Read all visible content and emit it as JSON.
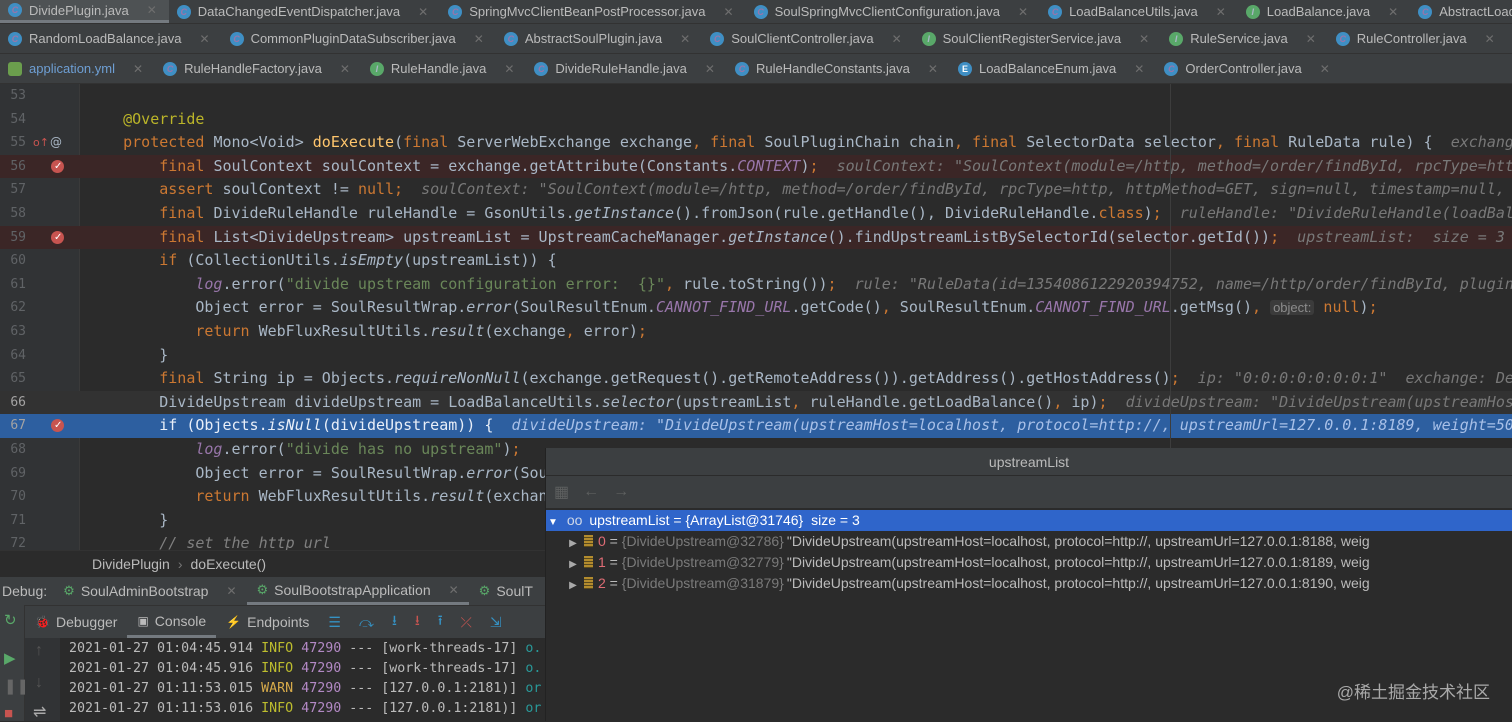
{
  "editor_tabs": [
    [
      {
        "label": "DividePlugin.java",
        "icon": "c",
        "active": true
      },
      {
        "label": "DataChangedEventDispatcher.java",
        "icon": "c"
      },
      {
        "label": "SpringMvcClientBeanPostProcessor.java",
        "icon": "c"
      },
      {
        "label": "SoulSpringMvcClientConfiguration.java",
        "icon": "c"
      },
      {
        "label": "LoadBalanceUtils.java",
        "icon": "c"
      },
      {
        "label": "LoadBalance.java",
        "icon": "i"
      },
      {
        "label": "AbstractLoadBalance.java",
        "icon": "c"
      }
    ],
    [
      {
        "label": "RandomLoadBalance.java",
        "icon": "c"
      },
      {
        "label": "CommonPluginDataSubscriber.java",
        "icon": "c"
      },
      {
        "label": "AbstractSoulPlugin.java",
        "icon": "c"
      },
      {
        "label": "SoulClientController.java",
        "icon": "c"
      },
      {
        "label": "SoulClientRegisterService.java",
        "icon": "i"
      },
      {
        "label": "RuleService.java",
        "icon": "i"
      },
      {
        "label": "RuleController.java",
        "icon": "c"
      }
    ],
    [
      {
        "label": "application.yml",
        "icon": "yml"
      },
      {
        "label": "RuleHandleFactory.java",
        "icon": "c"
      },
      {
        "label": "RuleHandle.java",
        "icon": "i"
      },
      {
        "label": "DivideRuleHandle.java",
        "icon": "c"
      },
      {
        "label": "RuleHandleConstants.java",
        "icon": "c"
      },
      {
        "label": "LoadBalanceEnum.java",
        "icon": "e"
      },
      {
        "label": "OrderController.java",
        "icon": "c"
      }
    ]
  ],
  "code_lines": [
    {
      "n": 53,
      "tokens": []
    },
    {
      "n": 54,
      "tokens": [
        [
          "a",
          "    @Override"
        ]
      ]
    },
    {
      "n": 55,
      "marks": [
        "override",
        "annotation"
      ],
      "tokens": [
        [
          "k",
          "    protected "
        ],
        [
          "t",
          "Mono<Void> "
        ],
        [
          "m",
          "doExecute"
        ],
        [
          "t",
          "("
        ],
        [
          "k",
          "final "
        ],
        [
          "t",
          "ServerWebExchange exchange"
        ],
        [
          "k",
          ", final "
        ],
        [
          "t",
          "SoulPluginChain chain"
        ],
        [
          "k",
          ", final "
        ],
        [
          "t",
          "SelectorData selector"
        ],
        [
          "k",
          ", final "
        ],
        [
          "t",
          "RuleData rule) {  "
        ],
        [
          "h",
          "exchang"
        ]
      ]
    },
    {
      "n": 56,
      "state": "bp",
      "marks": [
        "breakpoint"
      ],
      "tokens": [
        [
          "k",
          "        final "
        ],
        [
          "t",
          "SoulContext soulContext = exchange.getAttribute(Constants."
        ],
        [
          "c",
          "CONTEXT"
        ],
        [
          "t",
          ")"
        ],
        [
          "k",
          ";"
        ],
        [
          "h",
          "  soulContext: \"SoulContext(module=/http, method=/order/findById, rpcType=htt"
        ]
      ]
    },
    {
      "n": 57,
      "tokens": [
        [
          "k",
          "        assert "
        ],
        [
          "t",
          "soulContext != "
        ],
        [
          "k",
          "null;"
        ],
        [
          "h",
          "  soulContext: \"SoulContext(module=/http, method=/order/findById, rpcType=http, httpMethod=GET, sign=null, timestamp=null,"
        ]
      ]
    },
    {
      "n": 58,
      "tokens": [
        [
          "k",
          "        final "
        ],
        [
          "t",
          "DivideRuleHandle ruleHandle = GsonUtils."
        ],
        [
          "i",
          "getInstance"
        ],
        [
          "t",
          "().fromJson(rule.getHandle(), DivideRuleHandle."
        ],
        [
          "k",
          "class"
        ],
        [
          "t",
          ")"
        ],
        [
          "k",
          ";"
        ],
        [
          "h",
          "  ruleHandle: \"DivideRuleHandle(loadBal"
        ]
      ]
    },
    {
      "n": 59,
      "state": "bp",
      "marks": [
        "breakpoint"
      ],
      "tokens": [
        [
          "k",
          "        final "
        ],
        [
          "t",
          "List<DivideUpstream> upstreamList = UpstreamCacheManager."
        ],
        [
          "i",
          "getInstance"
        ],
        [
          "t",
          "().findUpstreamListBySelectorId(selector.getId())"
        ],
        [
          "k",
          ";"
        ],
        [
          "h",
          "  upstreamList:  size = 3"
        ]
      ]
    },
    {
      "n": 60,
      "tokens": [
        [
          "k",
          "        if "
        ],
        [
          "t",
          "(CollectionUtils."
        ],
        [
          "i",
          "isEmpty"
        ],
        [
          "t",
          "(upstreamList)) {"
        ]
      ]
    },
    {
      "n": 61,
      "tokens": [
        [
          "c",
          "            log"
        ],
        [
          "t",
          ".error("
        ],
        [
          "s",
          "\"divide upstream configuration error:  {}\""
        ],
        [
          "k",
          ", "
        ],
        [
          "t",
          "rule.toString())"
        ],
        [
          "k",
          ";"
        ],
        [
          "h",
          "  rule: \"RuleData(id=1354086122920394752, name=/http/order/findById, plugin"
        ]
      ]
    },
    {
      "n": 62,
      "tokens": [
        [
          "t",
          "            Object error = SoulResultWrap."
        ],
        [
          "i",
          "error"
        ],
        [
          "t",
          "(SoulResultEnum."
        ],
        [
          "c",
          "CANNOT_FIND_URL"
        ],
        [
          "t",
          ".getCode()"
        ],
        [
          "k",
          ", "
        ],
        [
          "t",
          "SoulResultEnum."
        ],
        [
          "c",
          "CANNOT_FIND_URL"
        ],
        [
          "t",
          ".getMsg()"
        ],
        [
          "k",
          ", "
        ],
        [
          "p",
          "object:"
        ],
        [
          "k",
          " null"
        ],
        [
          "t",
          ")"
        ],
        [
          "k",
          ";"
        ]
      ]
    },
    {
      "n": 63,
      "tokens": [
        [
          "k",
          "            return "
        ],
        [
          "t",
          "WebFluxResultUtils."
        ],
        [
          "i",
          "result"
        ],
        [
          "t",
          "(exchange"
        ],
        [
          "k",
          ", "
        ],
        [
          "t",
          "error)"
        ],
        [
          "k",
          ";"
        ]
      ]
    },
    {
      "n": 64,
      "tokens": [
        [
          "t",
          "        }"
        ]
      ]
    },
    {
      "n": 65,
      "tokens": [
        [
          "k",
          "        final "
        ],
        [
          "t",
          "String ip = Objects."
        ],
        [
          "i",
          "requireNonNull"
        ],
        [
          "t",
          "(exchange.getRequest().getRemoteAddress()).getAddress().getHostAddress()"
        ],
        [
          "k",
          ";"
        ],
        [
          "h",
          "  ip: \"0:0:0:0:0:0:0:1\"  exchange: De"
        ]
      ]
    },
    {
      "n": 66,
      "state": "cur",
      "tokens": [
        [
          "t",
          "        DivideUpstream divideUpstream = LoadBalanceUtils."
        ],
        [
          "i",
          "selector"
        ],
        [
          "t",
          "(upstreamList"
        ],
        [
          "k",
          ", "
        ],
        [
          "t",
          "ruleHandle.getLoadBalance()"
        ],
        [
          "k",
          ", "
        ],
        [
          "t",
          "ip)"
        ],
        [
          "k",
          ";"
        ],
        [
          "h",
          "  divideUpstream: \"DivideUpstream(upstreamHos"
        ]
      ]
    },
    {
      "n": 67,
      "state": "exec",
      "marks": [
        "breakpoint"
      ],
      "tokens": [
        [
          "k",
          "        if "
        ],
        [
          "t",
          "(Objects."
        ],
        [
          "i",
          "isNull"
        ],
        [
          "t",
          "(divideUpstream)) {"
        ],
        [
          "h",
          "  divideUpstream: \"DivideUpstream(upstreamHost=localhost, protocol=http://, upstreamUrl=127.0.0.1:8189, weight=50"
        ]
      ]
    },
    {
      "n": 68,
      "tokens": [
        [
          "c",
          "            log"
        ],
        [
          "t",
          ".error("
        ],
        [
          "s",
          "\"divide has no upstream\""
        ],
        [
          "t",
          ")"
        ],
        [
          "k",
          ";"
        ]
      ]
    },
    {
      "n": 69,
      "tokens": [
        [
          "t",
          "            Object error = SoulResultWrap."
        ],
        [
          "i",
          "error"
        ],
        [
          "t",
          "(Sou"
        ]
      ]
    },
    {
      "n": 70,
      "tokens": [
        [
          "k",
          "            return "
        ],
        [
          "t",
          "WebFluxResultUtils."
        ],
        [
          "i",
          "result"
        ],
        [
          "t",
          "(exchan"
        ]
      ]
    },
    {
      "n": 71,
      "tokens": [
        [
          "t",
          "        }"
        ]
      ]
    },
    {
      "n": 72,
      "tokens": [
        [
          "cm",
          "        // set the http url"
        ]
      ]
    }
  ],
  "breadcrumb": {
    "class": "DividePlugin",
    "method": "doExecute()"
  },
  "debug": {
    "label": "Debug:",
    "sessions": [
      {
        "label": "SoulAdminBootstrap"
      },
      {
        "label": "SoulBootstrapApplication",
        "active": true
      },
      {
        "label": "SoulT"
      }
    ],
    "tabs": [
      {
        "label": "Debugger"
      },
      {
        "label": "Console",
        "active": true
      },
      {
        "label": "Endpoints"
      }
    ]
  },
  "console_lines": [
    {
      "ts": "2021-01-27 01:04:45.914",
      "level": "INFO",
      "pid": "47290",
      "sep": "---",
      "thread": "[work-threads-17]",
      "logger": "o."
    },
    {
      "ts": "2021-01-27 01:04:45.916",
      "level": "INFO",
      "pid": "47290",
      "sep": "---",
      "thread": "[work-threads-17]",
      "logger": "o."
    },
    {
      "ts": "2021-01-27 01:11:53.015",
      "level": "WARN",
      "pid": "47290",
      "sep": "---",
      "thread": "[127.0.0.1:2181)]",
      "logger": "or"
    },
    {
      "ts": "2021-01-27 01:11:53.016",
      "level": "INFO",
      "pid": "47290",
      "sep": "---",
      "thread": "[127.0.0.1:2181)]",
      "logger": "or"
    }
  ],
  "popup": {
    "title": "upstreamList",
    "root": {
      "name": "upstreamList",
      "value": "= {ArrayList@31746}",
      "size": "size = 3"
    },
    "items": [
      {
        "index": "0",
        "ref": "{DivideUpstream@32786}",
        "value": "\"DivideUpstream(upstreamHost=localhost, protocol=http://, upstreamUrl=127.0.0.1:8188, weig"
      },
      {
        "index": "1",
        "ref": "{DivideUpstream@32779}",
        "value": "\"DivideUpstream(upstreamHost=localhost, protocol=http://, upstreamUrl=127.0.0.1:8189, weig"
      },
      {
        "index": "2",
        "ref": "{DivideUpstream@31879}",
        "value": "\"DivideUpstream(upstreamHost=localhost, protocol=http://, upstreamUrl=127.0.0.1:8190, weig"
      }
    ]
  },
  "watermark": "@稀土掘金技术社区"
}
